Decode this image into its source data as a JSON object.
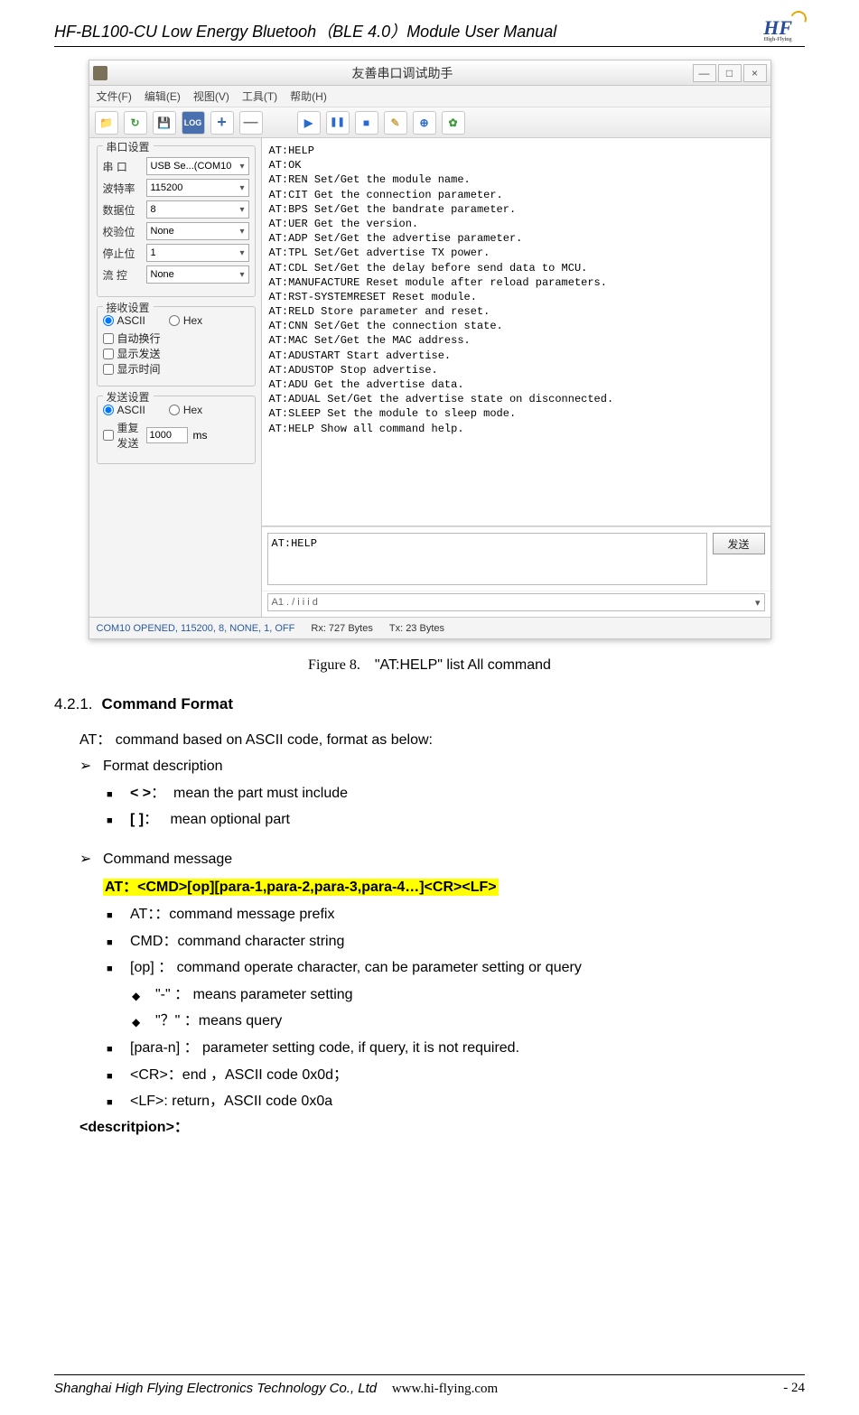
{
  "header": {
    "title": "HF-BL100-CU Low Energy Bluetooh（BLE 4.0）Module User Manual",
    "logo": "HF",
    "logo_sub": "High-Flying"
  },
  "window": {
    "title": "友善串口调试助手",
    "min": "—",
    "max": "□",
    "close": "×",
    "menu": {
      "file": "文件(F)",
      "edit": "编辑(E)",
      "view": "视图(V)",
      "tools": "工具(T)",
      "help": "帮助(H)"
    },
    "toolbar": {
      "log": "LOG",
      "plus": "+",
      "minus": "—",
      "play": "▶",
      "pause": "❚❚",
      "stop": "■"
    },
    "sidebar": {
      "port_group": "串口设置",
      "port_label": "串  口",
      "port_value": "USB Se...(COM10",
      "baud_label": "波特率",
      "baud_value": "115200",
      "data_label": "数据位",
      "data_value": "8",
      "parity_label": "校验位",
      "parity_value": "None",
      "stop_label": "停止位",
      "stop_value": "1",
      "flow_label": "流  控",
      "flow_value": "None",
      "recv_group": "接收设置",
      "ascii": "ASCII",
      "hex": "Hex",
      "autowrap": "自动换行",
      "showtx": "显示发送",
      "showtime": "显示时间",
      "send_group": "发送设置",
      "repeat": "重复发送",
      "repeat_value": "1000",
      "ms": "ms"
    },
    "output": "AT:HELP\nAT:OK\nAT:REN Set/Get the module name.\nAT:CIT Get the connection parameter.\nAT:BPS Set/Get the bandrate parameter.\nAT:UER Get the version.\nAT:ADP Set/Get the advertise parameter.\nAT:TPL Set/Get advertise TX power.\nAT:CDL Set/Get the delay before send data to MCU.\nAT:MANUFACTURE Reset module after reload parameters.\nAT:RST-SYSTEMRESET Reset module.\nAT:RELD Store parameter and reset.\nAT:CNN Set/Get the connection state.\nAT:MAC Set/Get the MAC address.\nAT:ADUSTART Start advertise.\nAT:ADUSTOP Stop advertise.\nAT:ADU Get the advertise data.\nAT:ADUAL Set/Get the advertise state on disconnected.\nAT:SLEEP Set the module to sleep mode.\nAT:HELP Show all command help.",
    "send_value": "AT:HELP",
    "send_btn": "发送",
    "history": "A1 . / i i i d",
    "status": {
      "left": "COM10 OPENED, 115200, 8, NONE, 1, OFF",
      "rx": "Rx: 727 Bytes",
      "tx": "Tx: 23 Bytes"
    }
  },
  "figure": {
    "num": "Figure 8.",
    "caption": "\"AT:HELP\" list All command"
  },
  "section": {
    "num": "4.2.1.",
    "title": "Command Format"
  },
  "para1": "AT： command based on ASCII code, format as below:",
  "l1_1": "Format description",
  "l2_1": "< >：  mean the part must include",
  "l2_2": "[ ]：   mean optional part",
  "l1_2": "Command message",
  "highlight": "AT：<CMD>[op][para-1,para-2,para-3,para-4…]<CR><LF>",
  "l2_3": "AT：：command message prefix",
  "l2_4": "CMD：command character string",
  "l2_5": "[op] ： command operate character,  can be parameter setting or query",
  "l3_1": "\"-\" ： means parameter setting",
  "l3_2": "\"？\" ：means query",
  "l2_6": "[para-n] ： parameter setting code,  if query, it is not required.",
  "l2_7": "<CR>：end ，ASCII code 0x0d；",
  "l2_8": "<LF>: return，ASCII code 0x0a",
  "desc": "<descritpion>：",
  "footer": {
    "left": "Shanghai High Flying Electronics Technology Co., Ltd",
    "url": "www.hi-flying.com",
    "page_prefix": "-   ",
    "page": "24"
  }
}
